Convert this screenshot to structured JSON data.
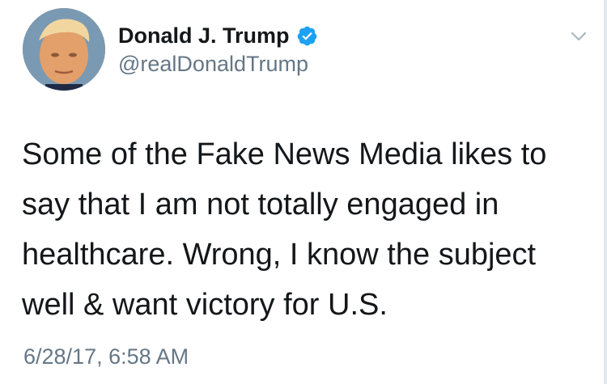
{
  "author": {
    "display_name": "Donald J. Trump",
    "handle": "@realDonaldTrump",
    "verified": true,
    "avatar_icon": "profile-photo"
  },
  "tweet": {
    "lines": [
      "Some of the Fake News Media likes to",
      "say that I am not totally engaged in",
      "healthcare. Wrong, I know the subject",
      "well & want victory for U.S."
    ],
    "timestamp": "6/28/17, 6:58 AM"
  },
  "icons": {
    "verified": "verified-badge-icon",
    "menu": "chevron-down-icon"
  },
  "colors": {
    "verified_blue": "#1da1f2",
    "secondary_text": "#657786",
    "primary_text": "#14171a"
  }
}
